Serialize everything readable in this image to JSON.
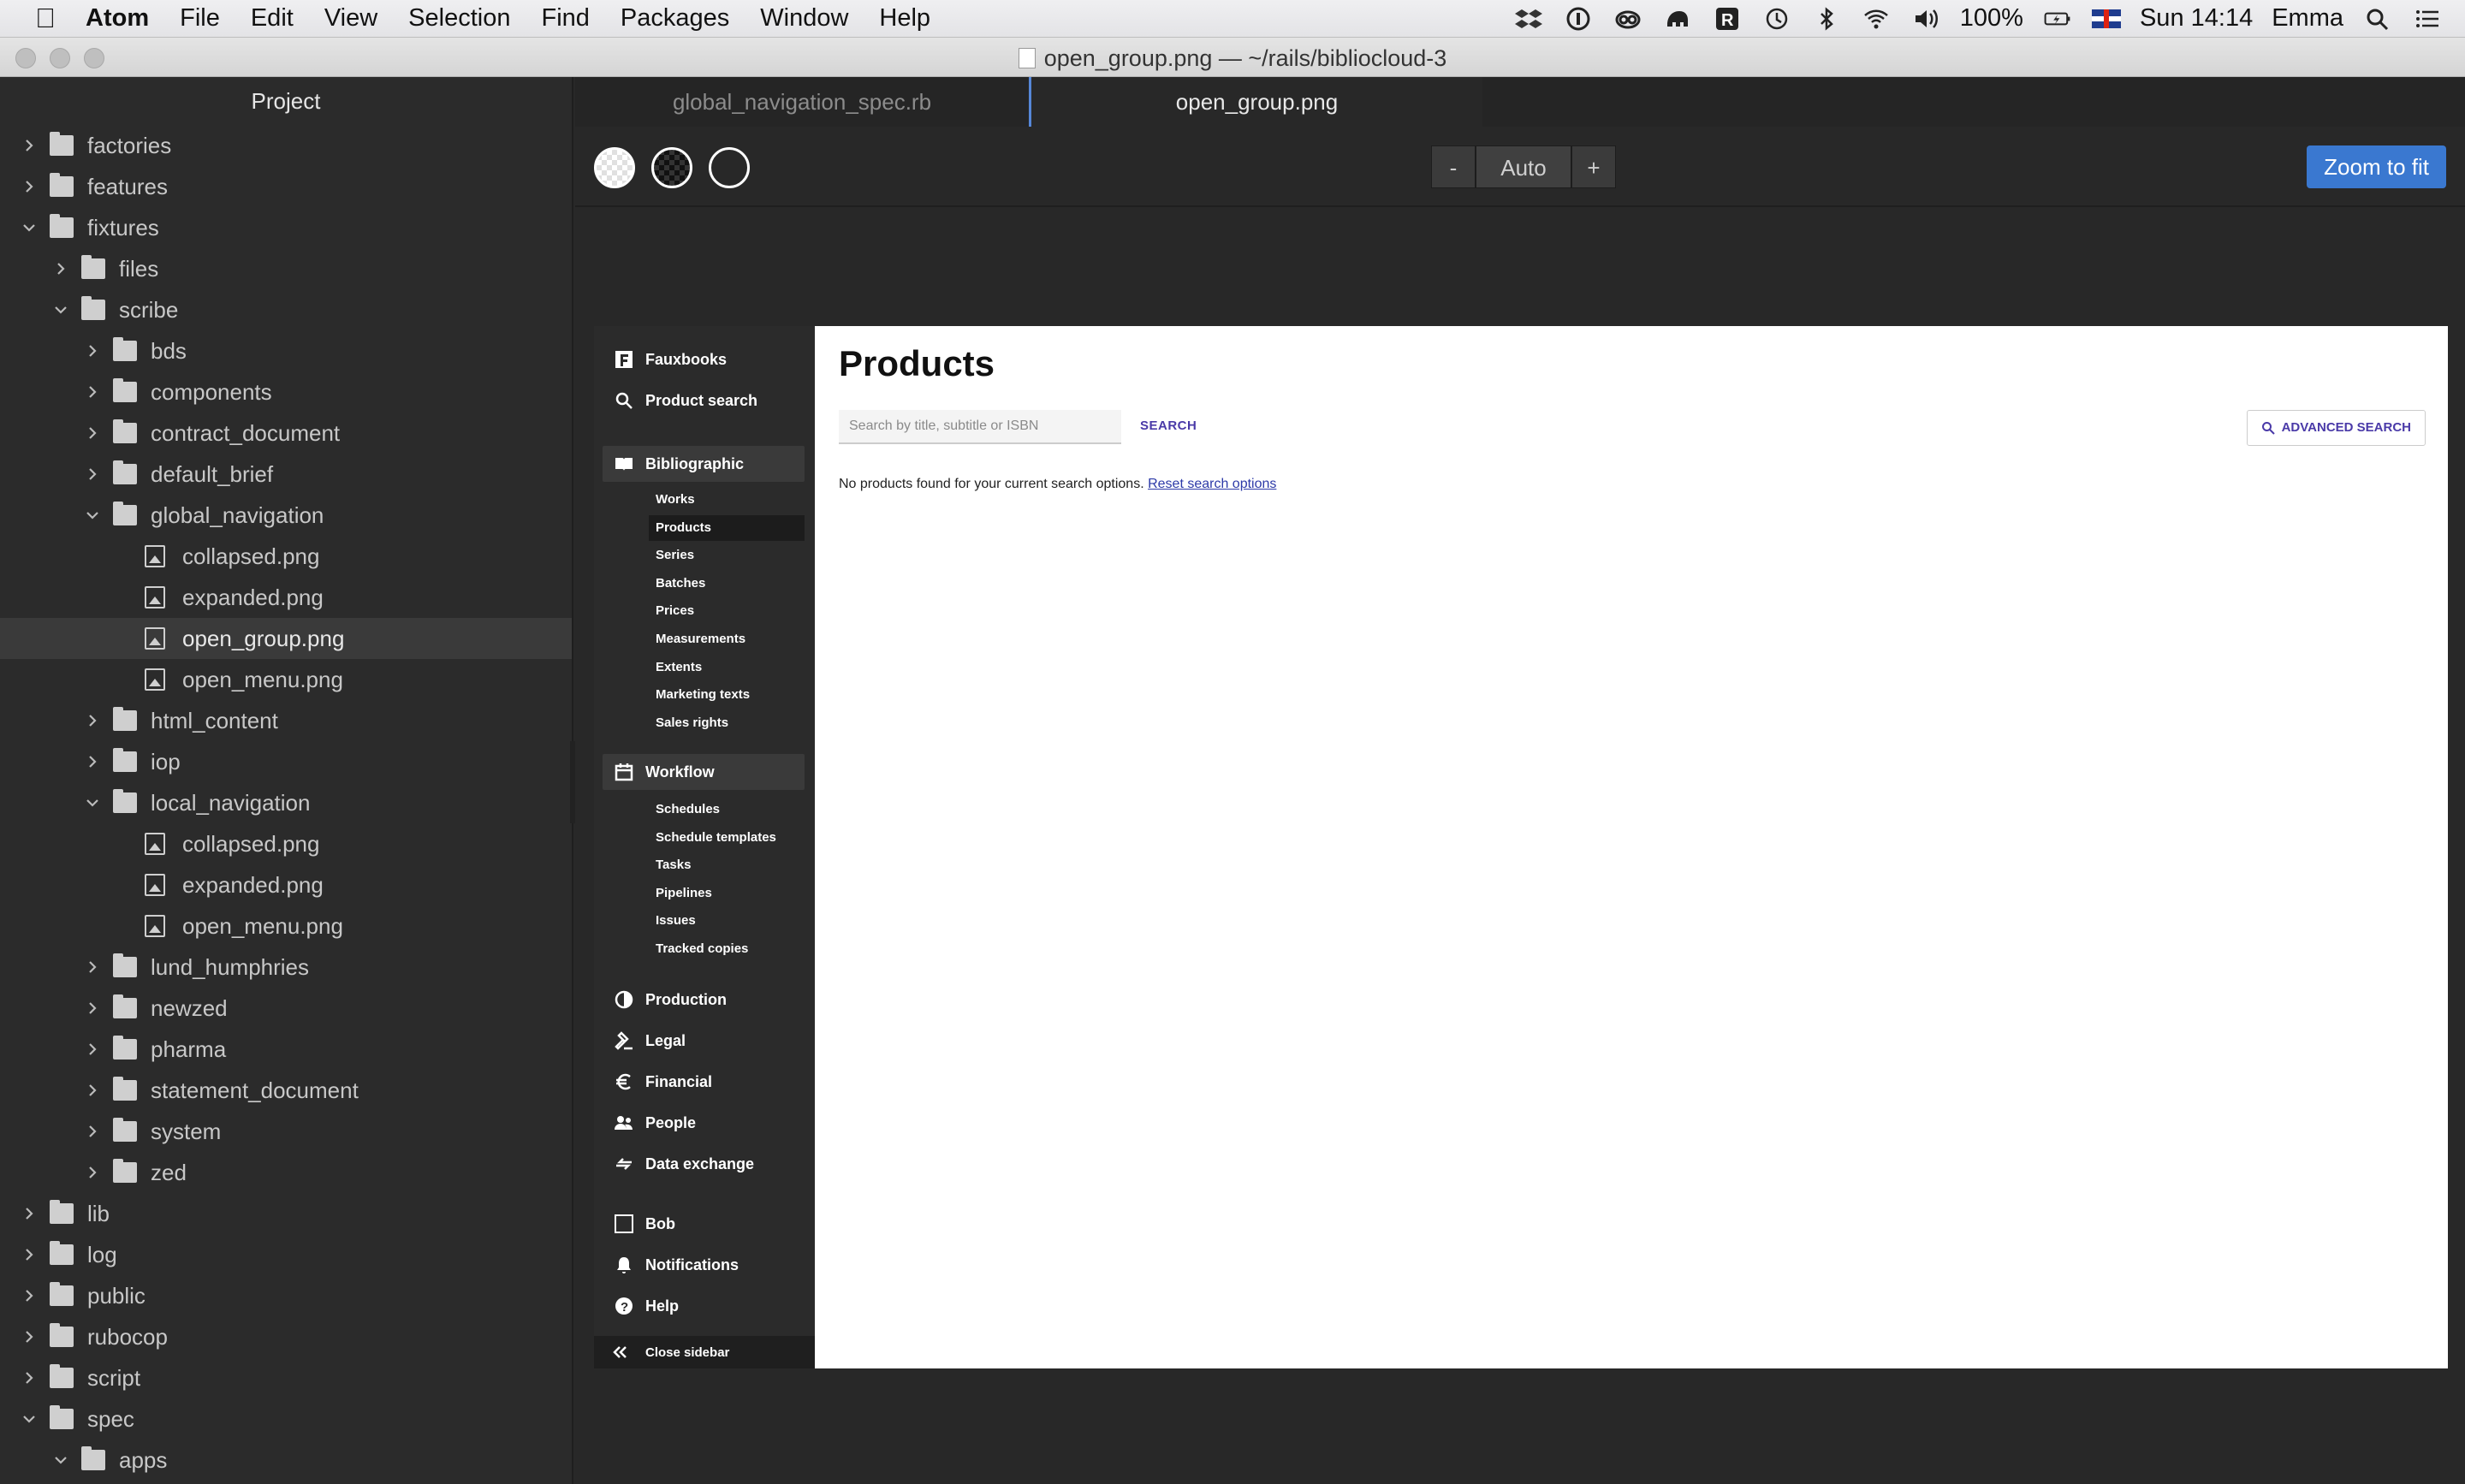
{
  "menubar": {
    "app": "Atom",
    "items": [
      "File",
      "Edit",
      "View",
      "Selection",
      "Find",
      "Packages",
      "Window",
      "Help"
    ],
    "battery": "100%",
    "clock": "Sun 14:14",
    "user": "Emma"
  },
  "window": {
    "title": "open_group.png — ~/rails/bibliocloud-3"
  },
  "tree": {
    "header": "Project",
    "rows": [
      {
        "label": "factories",
        "type": "folder",
        "depth": 0,
        "open": false
      },
      {
        "label": "features",
        "type": "folder",
        "depth": 0,
        "open": false
      },
      {
        "label": "fixtures",
        "type": "folder",
        "depth": 0,
        "open": true
      },
      {
        "label": "files",
        "type": "folder",
        "depth": 1,
        "open": false
      },
      {
        "label": "scribe",
        "type": "folder",
        "depth": 1,
        "open": true
      },
      {
        "label": "bds",
        "type": "folder",
        "depth": 2,
        "open": false
      },
      {
        "label": "components",
        "type": "folder",
        "depth": 2,
        "open": false
      },
      {
        "label": "contract_document",
        "type": "folder",
        "depth": 2,
        "open": false
      },
      {
        "label": "default_brief",
        "type": "folder",
        "depth": 2,
        "open": false
      },
      {
        "label": "global_navigation",
        "type": "folder",
        "depth": 2,
        "open": true
      },
      {
        "label": "collapsed.png",
        "type": "image",
        "depth": 3
      },
      {
        "label": "expanded.png",
        "type": "image",
        "depth": 3
      },
      {
        "label": "open_group.png",
        "type": "image",
        "depth": 3,
        "selected": true
      },
      {
        "label": "open_menu.png",
        "type": "image",
        "depth": 3
      },
      {
        "label": "html_content",
        "type": "folder",
        "depth": 2,
        "open": false
      },
      {
        "label": "iop",
        "type": "folder",
        "depth": 2,
        "open": false
      },
      {
        "label": "local_navigation",
        "type": "folder",
        "depth": 2,
        "open": true
      },
      {
        "label": "collapsed.png",
        "type": "image",
        "depth": 3
      },
      {
        "label": "expanded.png",
        "type": "image",
        "depth": 3
      },
      {
        "label": "open_menu.png",
        "type": "image",
        "depth": 3
      },
      {
        "label": "lund_humphries",
        "type": "folder",
        "depth": 2,
        "open": false
      },
      {
        "label": "newzed",
        "type": "folder",
        "depth": 2,
        "open": false
      },
      {
        "label": "pharma",
        "type": "folder",
        "depth": 2,
        "open": false
      },
      {
        "label": "statement_document",
        "type": "folder",
        "depth": 2,
        "open": false
      },
      {
        "label": "system",
        "type": "folder",
        "depth": 2,
        "open": false
      },
      {
        "label": "zed",
        "type": "folder",
        "depth": 2,
        "open": false
      },
      {
        "label": "lib",
        "type": "folder",
        "depth": 0,
        "open": false
      },
      {
        "label": "log",
        "type": "folder",
        "depth": 0,
        "open": false
      },
      {
        "label": "public",
        "type": "folder",
        "depth": 0,
        "open": false
      },
      {
        "label": "rubocop",
        "type": "folder",
        "depth": 0,
        "open": false
      },
      {
        "label": "script",
        "type": "folder",
        "depth": 0,
        "open": false
      },
      {
        "label": "spec",
        "type": "folder",
        "depth": 0,
        "open": true
      },
      {
        "label": "apps",
        "type": "folder",
        "depth": 1,
        "open": true
      }
    ]
  },
  "tabs": [
    {
      "label": "global_navigation_spec.rb",
      "active": false
    },
    {
      "label": "open_group.png",
      "active": true
    }
  ],
  "imageview": {
    "zoom_out": "-",
    "zoom_level": "Auto",
    "zoom_in": "+",
    "fit_label": "Zoom to fit"
  },
  "app": {
    "nav": {
      "top": [
        {
          "label": "Fauxbooks",
          "icon": "fauxbooks-logo-icon"
        },
        {
          "label": "Product search",
          "icon": "search-icon"
        }
      ],
      "groups": [
        {
          "label": "Bibliographic",
          "icon": "book-icon",
          "open": true,
          "items": [
            "Works",
            "Products",
            "Series",
            "Batches",
            "Prices",
            "Measurements",
            "Extents",
            "Marketing texts",
            "Sales rights"
          ],
          "active_item": "Products"
        },
        {
          "label": "Workflow",
          "icon": "calendar-icon",
          "open": true,
          "items": [
            "Schedules",
            "Schedule templates",
            "Tasks",
            "Pipelines",
            "Issues",
            "Tracked copies"
          ]
        },
        {
          "label": "Production",
          "icon": "production-icon",
          "open": false
        },
        {
          "label": "Legal",
          "icon": "gavel-icon",
          "open": false
        },
        {
          "label": "Financial",
          "icon": "euro-icon",
          "open": false
        },
        {
          "label": "People",
          "icon": "people-icon",
          "open": false
        },
        {
          "label": "Data exchange",
          "icon": "exchange-icon",
          "open": false
        }
      ],
      "bottom": [
        {
          "label": "Bob",
          "icon": "avatar-icon"
        },
        {
          "label": "Notifications",
          "icon": "bell-icon"
        },
        {
          "label": "Help",
          "icon": "help-icon"
        }
      ],
      "close_label": "Close sidebar"
    },
    "page": {
      "title": "Products",
      "search_placeholder": "Search by title, subtitle or ISBN",
      "search_button": "SEARCH",
      "advanced_button": "ADVANCED SEARCH",
      "empty_message": "No products found for your current search options.",
      "reset_link": "Reset search options"
    }
  }
}
